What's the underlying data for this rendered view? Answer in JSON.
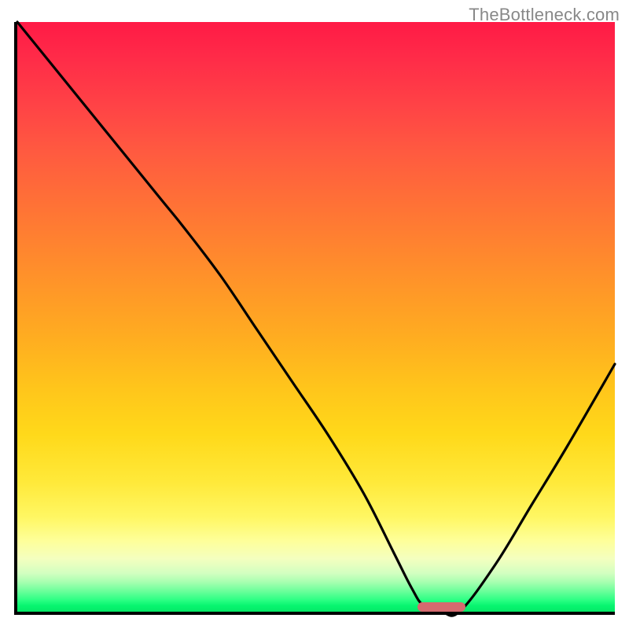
{
  "watermark": "TheBottleneck.com",
  "colors": {
    "axis": "#000000",
    "curve": "#000000",
    "pill": "#d66a6f",
    "gradient_top": "#ff1a46",
    "gradient_bottom": "#06e967"
  },
  "chart_data": {
    "type": "line",
    "title": "",
    "xlabel": "",
    "ylabel": "",
    "xlim": [
      0,
      100
    ],
    "ylim": [
      0,
      100
    ],
    "grid": false,
    "legend": false,
    "series": [
      {
        "name": "bottleneck-curve",
        "x": [
          0,
          8,
          16,
          24,
          28,
          34,
          40,
          46,
          52,
          58,
          63,
          66,
          68,
          71,
          74,
          80,
          86,
          92,
          100
        ],
        "y": [
          100,
          90,
          80,
          70,
          65,
          57,
          48,
          39,
          30,
          20,
          10,
          4,
          1,
          0,
          0,
          8,
          18,
          28,
          42
        ]
      }
    ],
    "annotations": [
      {
        "name": "min-marker-pill",
        "x_center": 71,
        "y": 0.8,
        "width_pct": 8,
        "height_pct": 1.6
      }
    ]
  }
}
